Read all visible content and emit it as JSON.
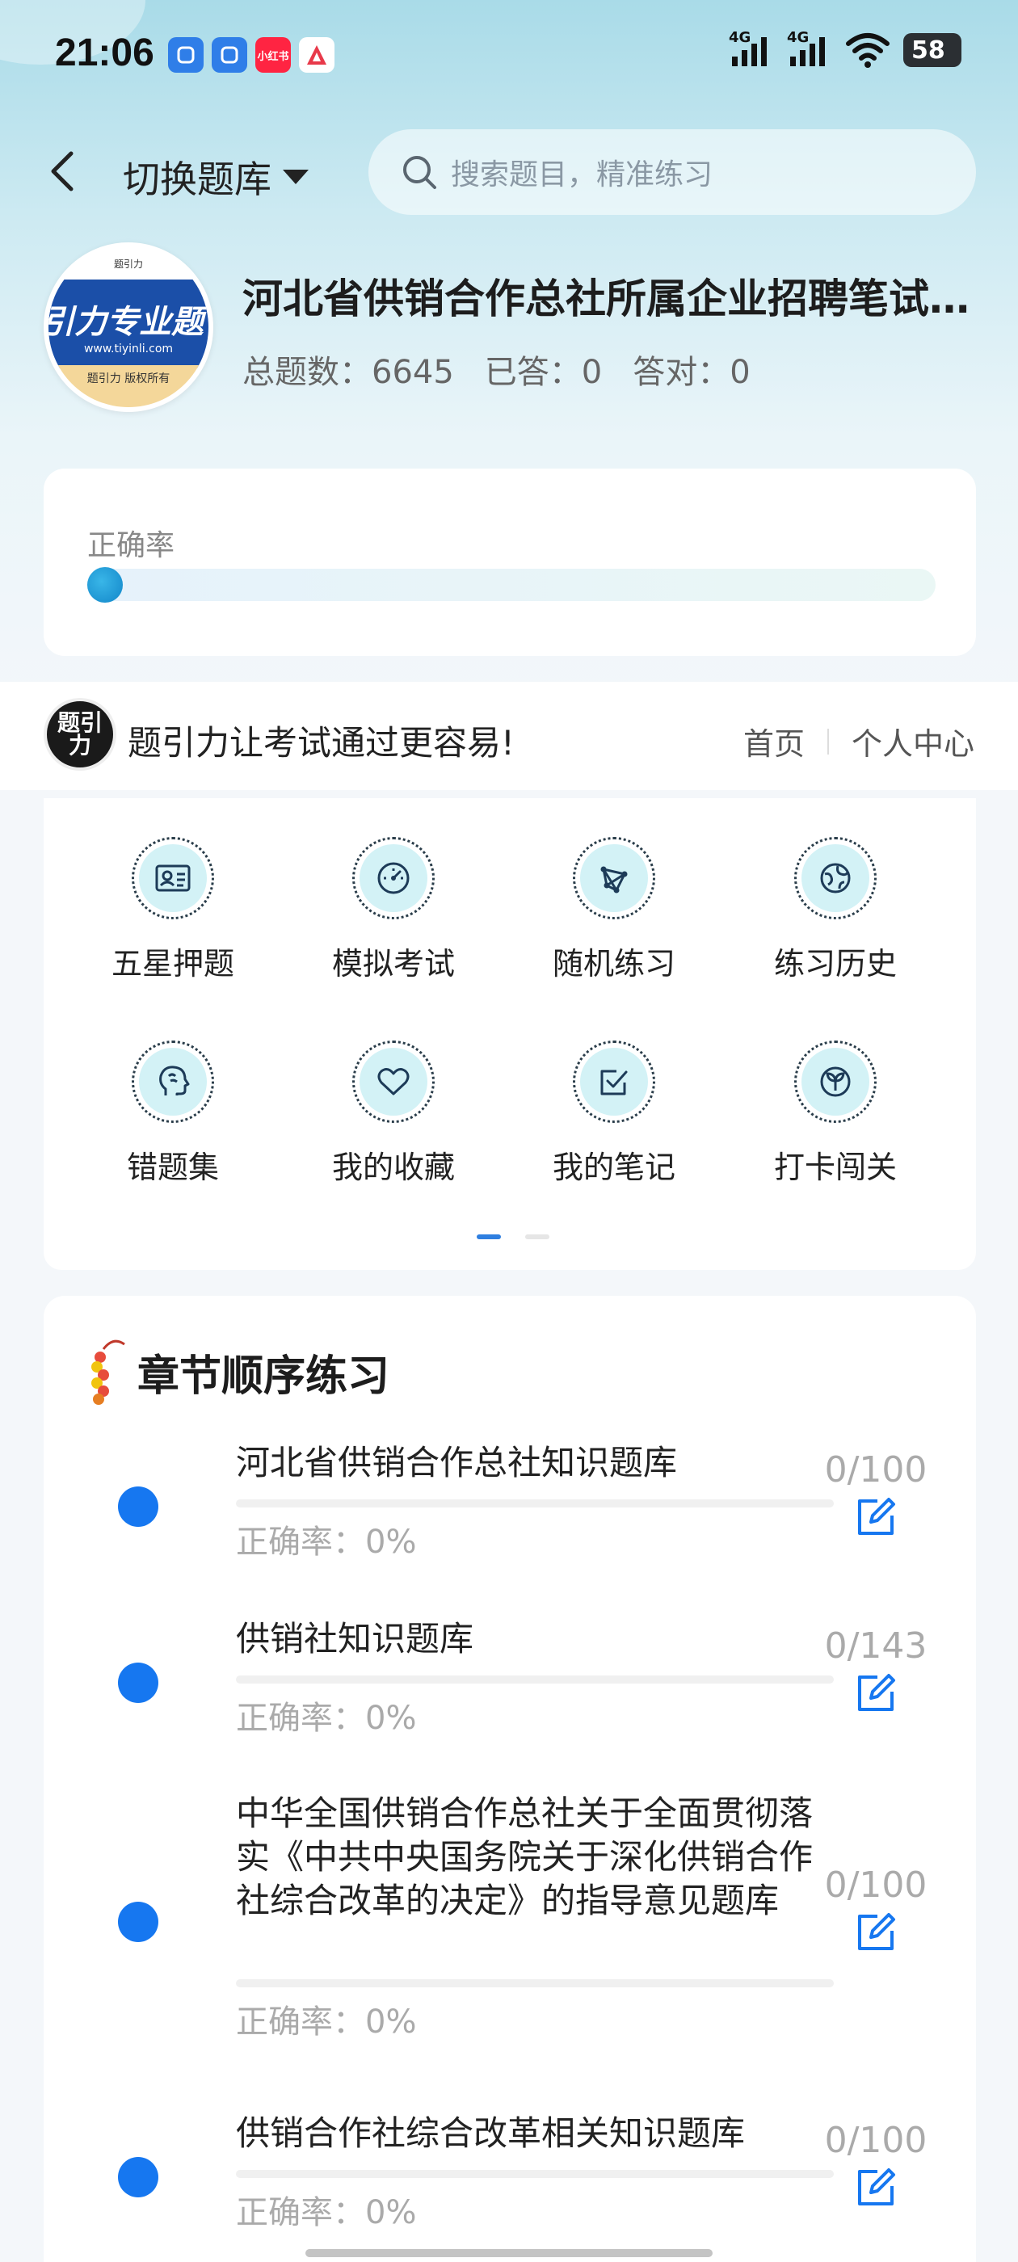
{
  "status_bar": {
    "time": "21:06",
    "apps": [
      {
        "icon": "app-icon-blue-1",
        "text": "",
        "color": "#2f7ee8"
      },
      {
        "icon": "app-icon-blue-2",
        "text": "",
        "color": "#2f7ee8"
      },
      {
        "icon": "xiaohongshu-icon",
        "text": "小红书",
        "color": "#ff2442"
      },
      {
        "icon": "app-icon-red-a",
        "text": "",
        "color": "#e8394a"
      }
    ],
    "signal1": "4G",
    "signal2": "4G",
    "battery": "58"
  },
  "header": {
    "switch_label": "切换题库",
    "search_placeholder": "搜索题目，精准练习"
  },
  "bank": {
    "logo_big": "引力专业题",
    "logo_url": "www.tiyinli.com",
    "logo_copy": "题引力 版权所有",
    "logo_mini": "题引力",
    "title": "河北省供销合作总社所属企业招聘笔试题库",
    "stats": [
      {
        "label": "总题数：",
        "value": "6645"
      },
      {
        "label": "已答：",
        "value": "0"
      },
      {
        "label": "答对：",
        "value": "0"
      }
    ]
  },
  "accuracy": {
    "label": "正确率",
    "value_percent": 0
  },
  "banner": {
    "logo_text": "题引力",
    "slogan": "题引力让考试通过更容易!",
    "nav": [
      "首页",
      "个人中心"
    ]
  },
  "menu": {
    "items": [
      {
        "label": "五星押题",
        "icon": "id-card-icon"
      },
      {
        "label": "模拟考试",
        "icon": "speedometer-icon"
      },
      {
        "label": "随机练习",
        "icon": "network-icon"
      },
      {
        "label": "练习历史",
        "icon": "globe-icon"
      },
      {
        "label": "错题集",
        "icon": "brain-head-icon"
      },
      {
        "label": "我的收藏",
        "icon": "heart-icon"
      },
      {
        "label": "我的笔记",
        "icon": "checkbox-icon"
      },
      {
        "label": "打卡闯关",
        "icon": "sprout-icon"
      }
    ],
    "page_indicator": {
      "current": 1,
      "total": 2
    }
  },
  "chapters": {
    "title": "章节顺序练习",
    "items": [
      {
        "name": "河北省供销合作总社知识题库",
        "accuracy": "正确率：0%",
        "count": "0/100"
      },
      {
        "name": "供销社知识题库",
        "accuracy": "正确率：0%",
        "count": "0/143"
      },
      {
        "name": "中华全国供销合作总社关于全面贯彻落实《中共中央国务院关于深化供销合作社综合改革的决定》的指导意见题库",
        "accuracy": "正确率：0%",
        "count": "0/100"
      },
      {
        "name": "供销合作社综合改革相关知识题库",
        "accuracy": "正确率：0%",
        "count": "0/100"
      }
    ]
  },
  "colors": {
    "accent": "#1677f0",
    "icon_bg": "#d3f2f6"
  }
}
